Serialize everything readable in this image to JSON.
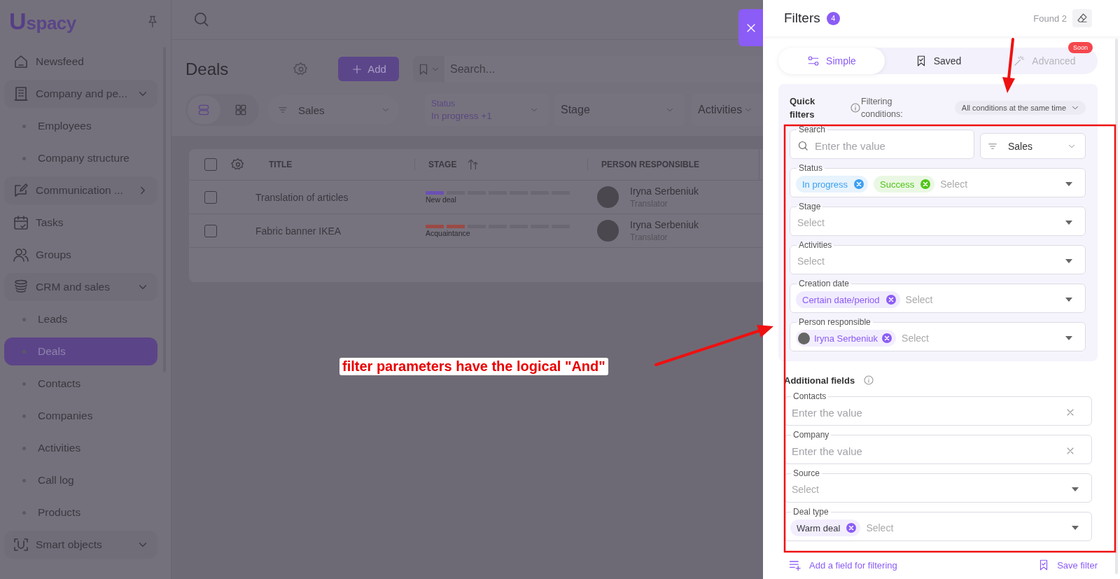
{
  "sidebar": {
    "logo": {
      "mark": "U",
      "text": "spacy"
    },
    "items": [
      {
        "label": "Newsfeed",
        "kind": "link",
        "selected": false
      },
      {
        "label": "Company and pe...",
        "kind": "group",
        "expanded": true,
        "selected": false,
        "children": [
          {
            "label": "Employees",
            "selected": false
          },
          {
            "label": "Company structure",
            "selected": false
          }
        ]
      },
      {
        "label": "Communication ...",
        "kind": "group",
        "expanded": false,
        "selected": false
      },
      {
        "label": "Tasks",
        "kind": "link",
        "selected": false
      },
      {
        "label": "Groups",
        "kind": "link",
        "selected": false
      },
      {
        "label": "CRM and sales",
        "kind": "group",
        "expanded": true,
        "selected": false,
        "children": [
          {
            "label": "Leads",
            "selected": false
          },
          {
            "label": "Deals",
            "selected": true
          },
          {
            "label": "Contacts",
            "selected": false
          },
          {
            "label": "Companies",
            "selected": false
          },
          {
            "label": "Activities",
            "selected": false
          },
          {
            "label": "Call log",
            "selected": false
          },
          {
            "label": "Products",
            "selected": false
          }
        ]
      },
      {
        "label": "Smart objects",
        "kind": "group",
        "expanded": true,
        "selected": false
      }
    ]
  },
  "page": {
    "title": "Deals",
    "add_button": "Add",
    "search": {
      "placeholder": "Search..."
    },
    "views": [
      {
        "kind": "list",
        "selected": true
      },
      {
        "kind": "grid",
        "selected": false
      }
    ],
    "pipeline": "Sales",
    "filters": [
      {
        "label": "Status",
        "value": "In progress +1"
      },
      {
        "label": "Stage"
      },
      {
        "label": "Activities"
      }
    ]
  },
  "table": {
    "header_checked": false,
    "columns": [
      {
        "label": "TITLE",
        "sorted": false
      },
      {
        "label": "STAGE",
        "sorted": true
      },
      {
        "label": "PERSON RESPONSIBLE",
        "sorted": false
      }
    ],
    "rows": [
      {
        "checked": false,
        "title": "Translation of articles",
        "stage": {
          "label": "New deal",
          "level": 0.143,
          "color": "#6b50b4"
        },
        "person": {
          "name": "Iryna Serbeniuk",
          "role": "Translator"
        }
      },
      {
        "checked": false,
        "title": "Fabric banner IKEA",
        "stage": {
          "label": "Acquaintance",
          "level": 0.286,
          "color": "#9c4a45"
        },
        "person": {
          "name": "Iryna Serbeniuk",
          "role": "Translator"
        }
      }
    ]
  },
  "filters": {
    "title": "Filters",
    "count": "4",
    "found": "Found 2",
    "tabs": [
      {
        "label": "Simple",
        "kind": "simple",
        "selected": true,
        "disabled": false
      },
      {
        "label": "Saved",
        "kind": "saved",
        "selected": false,
        "disabled": false
      },
      {
        "label": "Advanced",
        "kind": "advanced",
        "selected": false,
        "disabled": true,
        "badge": "Soon"
      }
    ],
    "quick": {
      "title": "Quick filters",
      "conditions_label": "Filtering conditions:",
      "conditions_value": "All conditions at the same time",
      "fields": [
        {
          "kind": "search",
          "label": "Search",
          "placeholder": "Enter the value",
          "pipeline": "Sales"
        },
        {
          "kind": "select",
          "label": "Status",
          "chips": [
            {
              "label": "In progress",
              "kind": "colored",
              "color": "#3b9ff2"
            },
            {
              "label": "Success",
              "kind": "colored",
              "color": "#52c41a"
            }
          ],
          "placeholder": "Select"
        },
        {
          "kind": "select",
          "label": "Stage",
          "placeholder": "Select"
        },
        {
          "kind": "select",
          "label": "Activities",
          "placeholder": "Select"
        },
        {
          "kind": "select",
          "label": "Creation date",
          "chips": [
            {
              "label": "Certain date/period",
              "kind": "colored",
              "color": "#8b5cf6"
            }
          ],
          "placeholder": "Select"
        },
        {
          "kind": "select",
          "label": "Person responsible",
          "chips": [
            {
              "label": "Iryna Serbeniuk",
              "kind": "person",
              "color": "#8b5cf6"
            }
          ],
          "placeholder": "Select"
        }
      ]
    },
    "additional": {
      "title": "Additional fields",
      "fields": [
        {
          "kind": "text",
          "label": "Contacts",
          "placeholder": "Enter the value"
        },
        {
          "kind": "text",
          "label": "Company",
          "placeholder": "Enter the value"
        },
        {
          "kind": "select",
          "label": "Source",
          "placeholder": "Select"
        },
        {
          "kind": "select",
          "label": "Deal type",
          "chips": [
            {
              "label": "Warm deal",
              "kind": "plain",
              "color": "#8b5cf6"
            }
          ],
          "placeholder": "Select"
        }
      ]
    },
    "add_field": "Add a field for filtering",
    "save": "Save filter"
  },
  "annotation": {
    "callout": "filter parameters have the logical \"And\""
  }
}
